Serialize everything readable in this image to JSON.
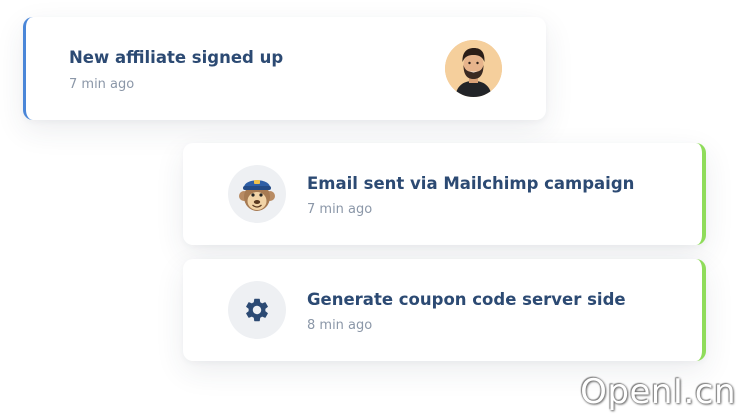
{
  "notifications": [
    {
      "title": "New affiliate signed up",
      "time": "7 min ago",
      "icon": "avatar-photo",
      "accent": "#4a86d8"
    },
    {
      "title": "Email sent via Mailchimp campaign",
      "time": "7 min ago",
      "icon": "mailchimp-icon",
      "accent": "#8fdc5a"
    },
    {
      "title": "Generate coupon code server side",
      "time": "8 min ago",
      "icon": "gear-icon",
      "accent": "#8fdc5a"
    }
  ],
  "watermark": "OpenI.cn"
}
